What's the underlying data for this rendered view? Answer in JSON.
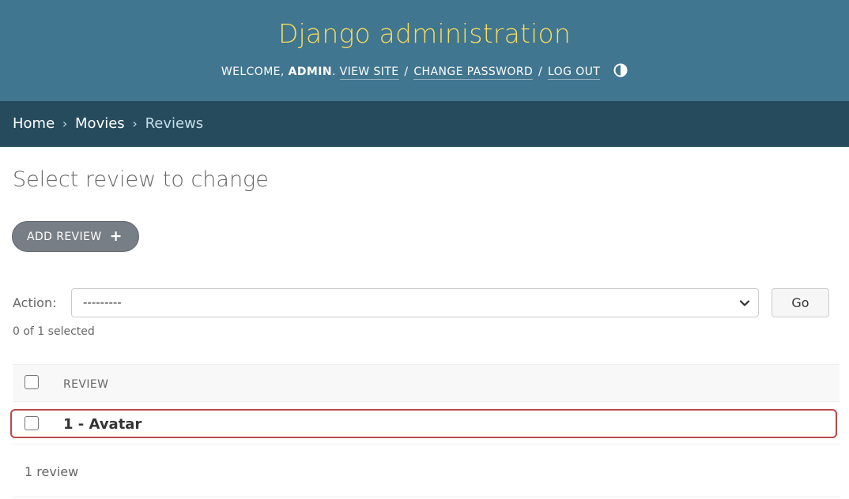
{
  "header": {
    "site_title": "Django administration",
    "welcome": "WELCOME,",
    "username": "ADMIN",
    "view_site": "VIEW SITE",
    "change_password": "CHANGE PASSWORD",
    "log_out": "LOG OUT",
    "separator": "/",
    "theme_icon": "contrast-icon",
    "bg_color": "#417690",
    "title_color": "#f5dd5d"
  },
  "breadcrumbs": {
    "home": "Home",
    "app": "Movies",
    "current": "Reviews",
    "arrow": "›",
    "bg_color": "#264b5d"
  },
  "content": {
    "title": "Select review to change",
    "add_button": "ADD REVIEW",
    "add_icon": "plus-icon"
  },
  "actions": {
    "label": "Action:",
    "selected_option": "---------",
    "go_button": "Go",
    "selected_count": "0 of 1 selected"
  },
  "table": {
    "column_header": "REVIEW",
    "rows": [
      {
        "label": "1 - Avatar",
        "checked": false
      }
    ],
    "highlight_color": "#b94a4a"
  },
  "paginator": {
    "text": "1 review"
  }
}
